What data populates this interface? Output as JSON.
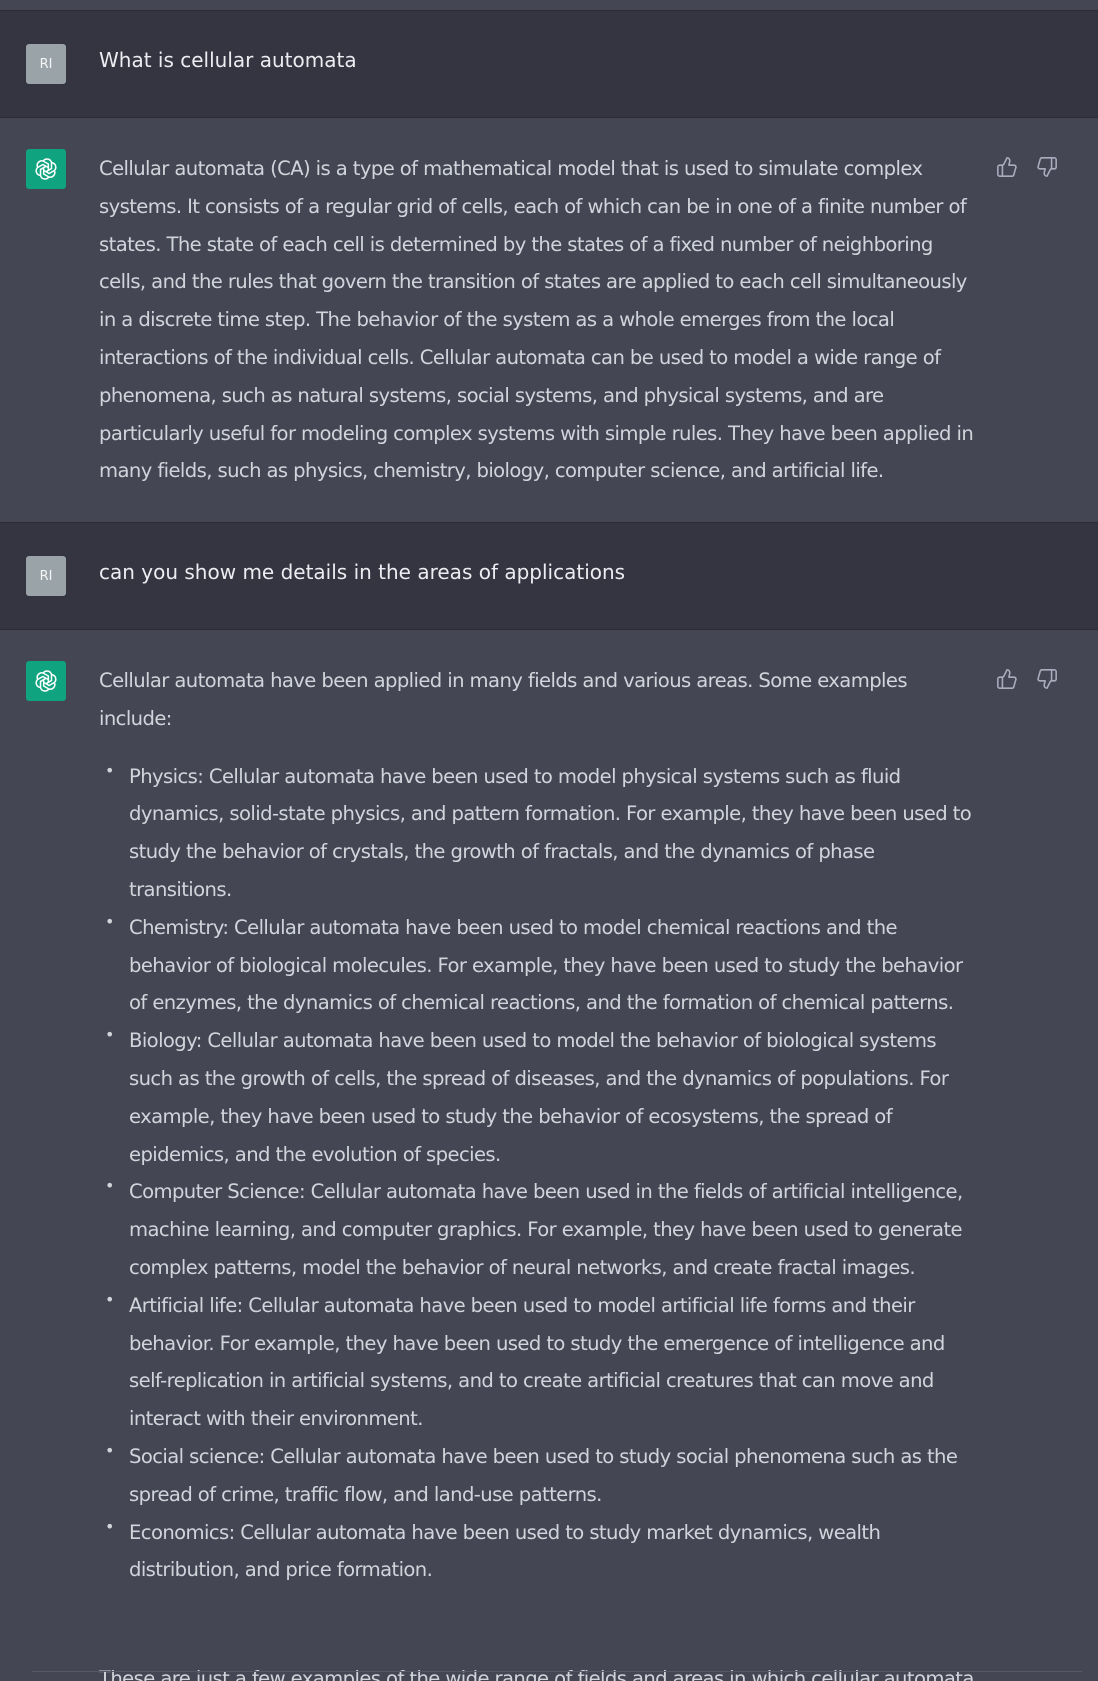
{
  "conversation": {
    "user_avatar_initials": "RI",
    "turns": [
      {
        "role": "user",
        "text": "What is cellular automata"
      },
      {
        "role": "assistant",
        "paragraph": "Cellular automata (CA) is a type of mathematical model that is used to simulate complex systems. It consists of a regular grid of cells, each of which can be in one of a finite number of states. The state of each cell is determined by the states of a fixed number of neighboring cells, and the rules that govern the transition of states are applied to each cell simultaneously in a discrete time step. The behavior of the system as a whole emerges from the local interactions of the individual cells. Cellular automata can be used to model a wide range of phenomena, such as natural systems, social systems, and physical systems, and are particularly useful for modeling complex systems with simple rules. They have been applied in many fields, such as physics, chemistry, biology, computer science, and artificial life."
      },
      {
        "role": "user",
        "text": "can you show me details in the areas of applications"
      },
      {
        "role": "assistant",
        "intro": "Cellular automata have been applied in many fields and various areas. Some examples include:",
        "items": [
          "Physics: Cellular automata have been used to model physical systems such as fluid dynamics, solid-state physics, and pattern formation. For example, they have been used to study the behavior of crystals, the growth of fractals, and the dynamics of phase transitions.",
          "Chemistry: Cellular automata have been used to model chemical reactions and the behavior of biological molecules. For example, they have been used to study the behavior of enzymes, the dynamics of chemical reactions, and the formation of chemical patterns.",
          "Biology: Cellular automata have been used to model the behavior of biological systems such as the growth of cells, the spread of diseases, and the dynamics of populations. For example, they have been used to study the behavior of ecosystems, the spread of epidemics, and the evolution of species.",
          "Computer Science: Cellular automata have been used in the fields of artificial intelligence, machine learning, and computer graphics. For example, they have been used to generate complex patterns, model the behavior of neural networks, and create fractal images.",
          "Artificial life: Cellular automata have been used to model artificial life forms and their behavior. For example, they have been used to study the emergence of intelligence and self-replication in artificial systems, and to create artificial creatures that can move and interact with their environment.",
          "Social science: Cellular automata have been used to study social phenomena such as the spread of crime, traffic flow, and land-use patterns.",
          "Economics: Cellular automata have been used to study market dynamics, wealth distribution, and price formation."
        ],
        "trailing_text": "These are just a few examples of the wide range of fields and areas in which cellular automata have been applied."
      }
    ]
  },
  "icons": {
    "assistant_avatar": "openai-logo-icon",
    "thumbs_up": "thumbs-up-icon",
    "thumbs_down": "thumbs-down-icon"
  },
  "colors": {
    "user_background": "#343541",
    "assistant_background": "#444654",
    "assistant_avatar": "#10a37f",
    "user_avatar": "#9aa3a7",
    "text": "#d1d5db"
  }
}
